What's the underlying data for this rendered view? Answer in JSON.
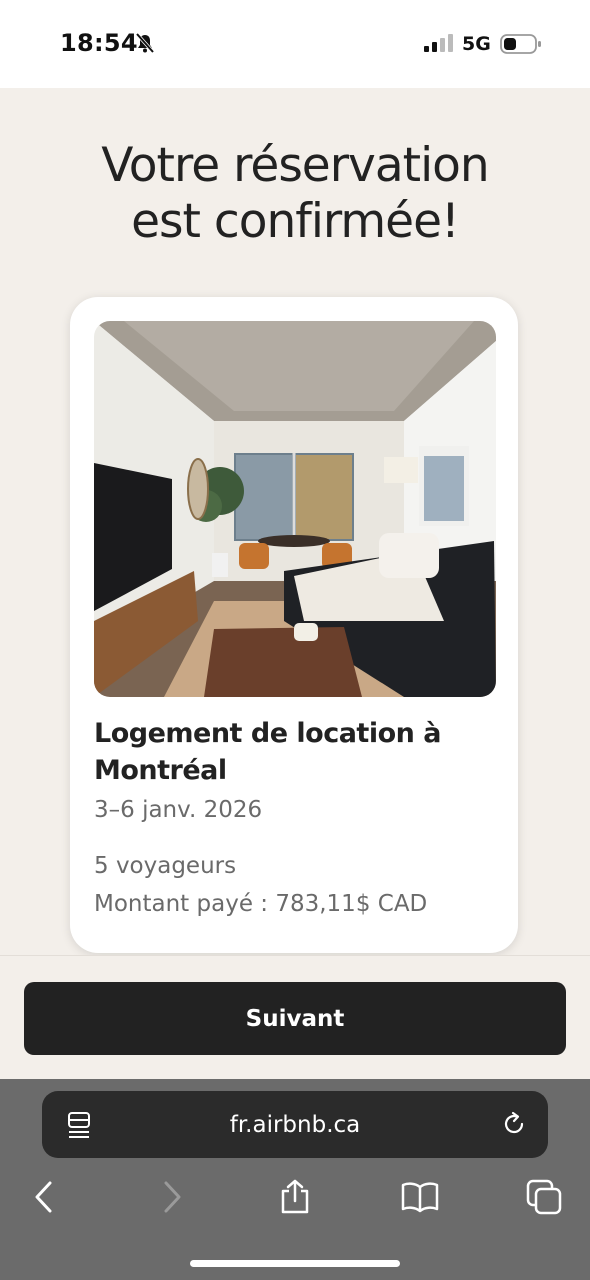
{
  "status_bar": {
    "time": "18:54",
    "network": "5G",
    "icons": [
      "bell-slash-icon",
      "signal-icon",
      "battery-icon"
    ]
  },
  "confirmation": {
    "title_line1": "Votre réservation",
    "title_line2": "est confirmée!"
  },
  "listing": {
    "photo": "living-room-photo",
    "title": "Logement de location à Montréal",
    "dates": "3–6 janv. 2026",
    "guests": "5 voyageurs",
    "amount_paid": "Montant payé : 783,11$ CAD"
  },
  "actions": {
    "next_label": "Suivant"
  },
  "browser": {
    "url": "fr.airbnb.ca",
    "toolbar_icons": [
      "back-icon",
      "forward-icon",
      "share-icon",
      "bookmarks-icon",
      "tabs-icon"
    ],
    "colors": {
      "chrome": "#6b6b6b",
      "address_bar": "#2b2b2b"
    }
  },
  "colors": {
    "background": "#f3efea",
    "button": "#222222",
    "text_primary": "#222222",
    "text_secondary": "#6a6a6a"
  }
}
